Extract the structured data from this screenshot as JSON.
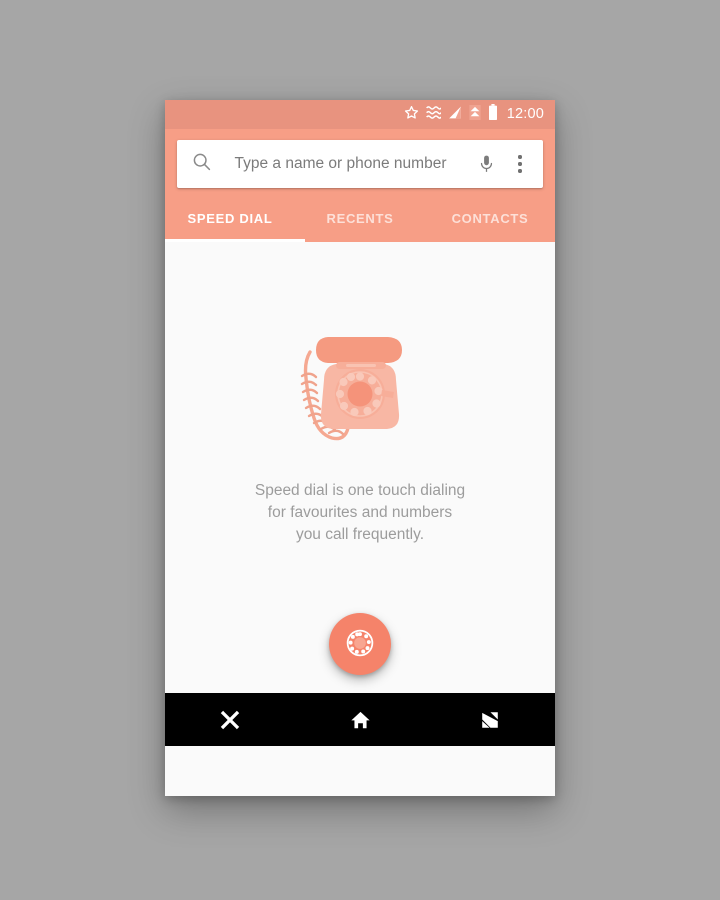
{
  "theme": {
    "accent": "#f79e86",
    "accent_dark": "#e8937f",
    "fab": "#f5836a",
    "body_bg": "#fafafa",
    "navbar": "#000000",
    "desktop_bg": "#a6a6a6",
    "illustration_light": "#f9c6b6",
    "illustration_mid": "#f7ab96",
    "illustration_dark": "#f59377",
    "text_muted": "#9c9c9c"
  },
  "status_bar": {
    "time": "12:00",
    "icons": [
      "star-icon",
      "alarm-wave-icon",
      "signal-icon",
      "upload-arrow-icon",
      "battery-icon"
    ]
  },
  "search": {
    "placeholder": "Type a name or phone number",
    "value": "",
    "search_icon": "search-icon",
    "voice_icon": "microphone-icon",
    "overflow_icon": "overflow-menu-icon"
  },
  "tabs": {
    "items": [
      {
        "label": "SPEED DIAL",
        "active": true
      },
      {
        "label": "RECENTS",
        "active": false
      },
      {
        "label": "CONTACTS",
        "active": false
      }
    ]
  },
  "main": {
    "illustration": "rotary-telephone-illustration",
    "empty_state": {
      "line1": "Speed dial is one touch dialing",
      "line2": "for favourites and numbers",
      "line3": "you call frequently."
    },
    "fab": {
      "icon": "rotary-dial-icon",
      "label": "Dialpad"
    }
  },
  "navbar": {
    "items": [
      {
        "icon": "close-icon",
        "label": "Back"
      },
      {
        "icon": "home-icon",
        "label": "Home"
      },
      {
        "icon": "recents-icon",
        "label": "Recents"
      }
    ]
  }
}
